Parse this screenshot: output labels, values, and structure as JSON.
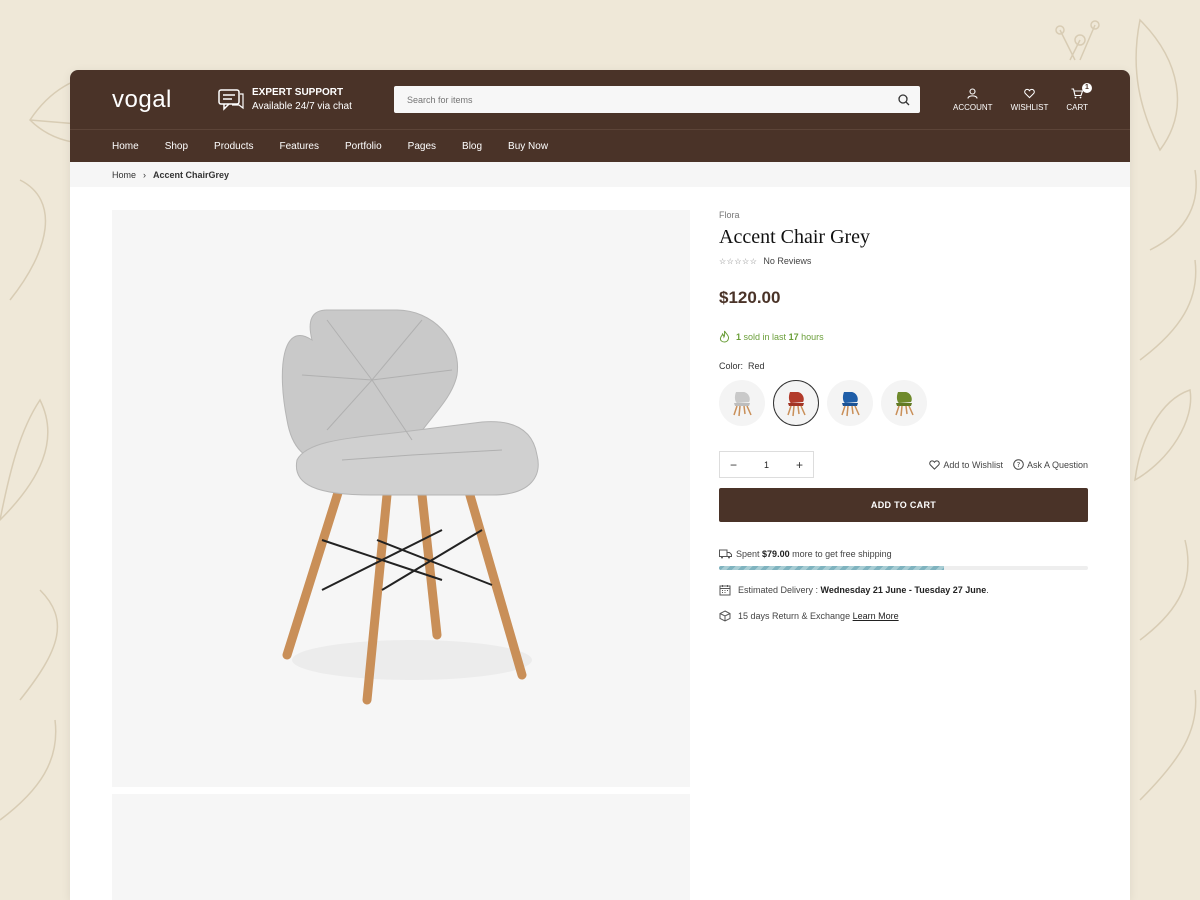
{
  "brand": {
    "logo": "vogal"
  },
  "support": {
    "title": "EXPERT SUPPORT",
    "subtitle": "Available 24/7 via chat"
  },
  "search": {
    "placeholder": "Search for items"
  },
  "header_icons": {
    "account": "ACCOUNT",
    "wishlist": "WISHLIST",
    "cart": "CART",
    "cart_count": "1"
  },
  "nav": [
    "Home",
    "Shop",
    "Products",
    "Features",
    "Portfolio",
    "Pages",
    "Blog",
    "Buy Now"
  ],
  "breadcrumb": {
    "home": "Home",
    "current": "Accent ChairGrey"
  },
  "product": {
    "vendor": "Flora",
    "title": "Accent Chair Grey",
    "stars": "☆☆☆☆☆",
    "reviews": "No Reviews",
    "price": "$120.00",
    "sold_count": "1",
    "sold_mid": "sold in last",
    "sold_hours": "17",
    "sold_suffix": "hours",
    "color_label": "Color:",
    "color_value": "Red",
    "swatches": [
      {
        "name": "Grey",
        "color": "#c9c9c9"
      },
      {
        "name": "Red",
        "color": "#b23b2b"
      },
      {
        "name": "Blue",
        "color": "#1f5ea8"
      },
      {
        "name": "Green",
        "color": "#6f8a2c"
      }
    ],
    "quantity": "1",
    "wishlist_link": "Add to Wishlist",
    "question_link": "Ask A Question",
    "add_to_cart": "ADD TO CART",
    "shipping_prefix": "Spent",
    "shipping_amount": "$79.00",
    "shipping_suffix": "more to get free shipping",
    "shipping_progress": 0.61,
    "delivery_prefix": "Estimated Delivery :",
    "delivery_dates": "Wednesday 21 June - Tuesday 27 June",
    "returns_text": "15 days Return & Exchange",
    "returns_link": "Learn More"
  },
  "colors": {
    "brand_brown": "#4a3328",
    "sold_green": "#6b9f3a",
    "progress": "#7fb3bf"
  }
}
